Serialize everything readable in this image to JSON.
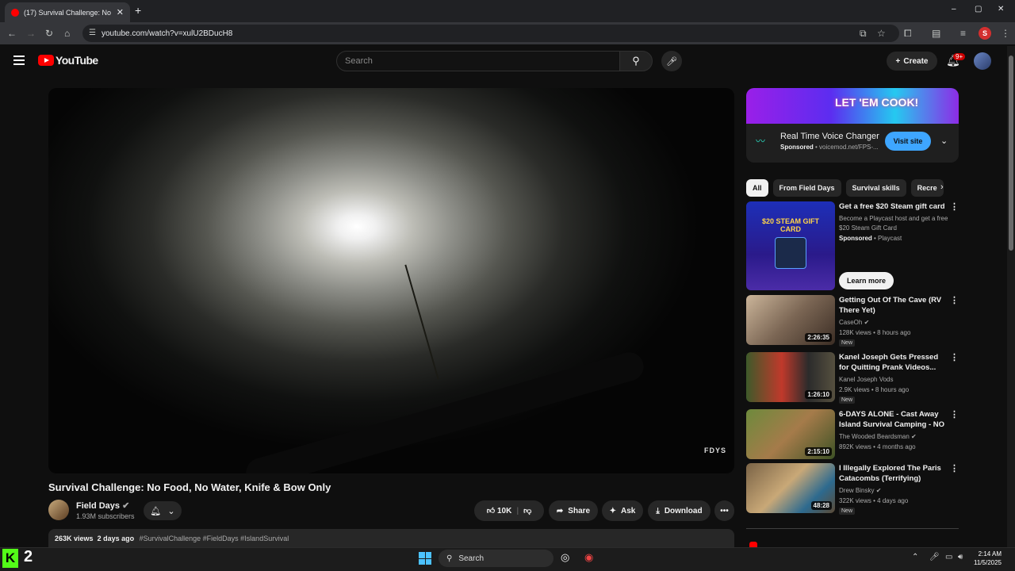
{
  "browser": {
    "tab_title": "(17) Survival Challenge: No Foo",
    "tab_close": "✕",
    "new_tab": "+",
    "url": "youtube.com/watch?v=xulU2BDucH8",
    "profile_letter": "S",
    "window_controls": [
      "–",
      "▢",
      "✕"
    ]
  },
  "header": {
    "logo_text": "YouTube",
    "search_placeholder": "Search",
    "create_label": "Create",
    "notification_count": "9+"
  },
  "video": {
    "watermark": "FDYS",
    "title": "Survival Challenge: No Food, No Water, Knife & Bow Only",
    "channel": "Field Days",
    "subscribers": "1.93M subscribers",
    "like_count": "10K",
    "share_label": "Share",
    "ask_label": "Ask",
    "download_label": "Download",
    "more_label": "•••",
    "views": "263K views",
    "age": "2 days ago",
    "hashtags": "#SurvivalChallenge #FieldDays #IslandSurvival"
  },
  "ad": {
    "banner_text": "LET 'EM COOK!",
    "title": "Real Time Voice Changer",
    "sponsored": "Sponsored",
    "domain": "voicemod.net/FPS-...",
    "cta": "Visit site"
  },
  "chips": [
    "All",
    "From Field Days",
    "Survival skills",
    "Recre"
  ],
  "sponsored_card": {
    "title": "Get a free $20 Steam gift card",
    "description": "Become a Playcast host and get a free $20 Steam Gift Card",
    "sponsored": "Sponsored",
    "advertiser": "Playcast",
    "cta": "Learn more",
    "thumb_text": "$20 STEAM GIFT CARD"
  },
  "recommendations": [
    {
      "title": "Getting Out Of The Cave (RV There Yet)",
      "channel": "CaseOh",
      "meta": "128K views • 8 hours ago",
      "duration": "2:26:35",
      "new": "New"
    },
    {
      "title": "Kanel Joseph Gets Pressed for Quitting Prank Videos...",
      "channel": "Kanel Joseph Vods",
      "meta": "2.9K views • 8 hours ago",
      "duration": "1:26:10",
      "new": "New"
    },
    {
      "title": "6-DAYS ALONE - Cast Away Island Survival Camping - NO ...",
      "channel": "The Wooded Beardsman",
      "meta": "892K views • 4 months ago",
      "duration": "2:15:10",
      "new": ""
    },
    {
      "title": "I Illegally Explored The Paris Catacombs (Terrifying)",
      "channel": "Drew Binsky",
      "meta": "322K views • 4 days ago",
      "duration": "48:28",
      "new": "New"
    }
  ],
  "taskbar": {
    "kick_letter": "K",
    "kick_number": "2",
    "search_label": "Search",
    "time": "2:14 AM",
    "date": "11/5/2025"
  }
}
